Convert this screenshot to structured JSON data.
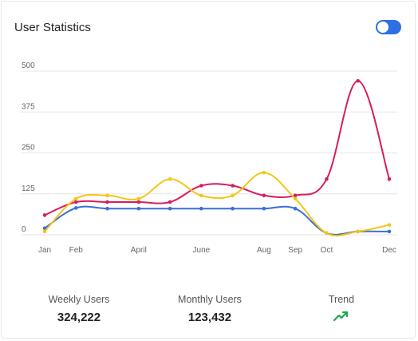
{
  "card": {
    "title": "User Statistics",
    "toggle_on": true
  },
  "stats": {
    "weekly_label": "Weekly Users",
    "weekly_value": "324,222",
    "monthly_label": "Monthly Users",
    "monthly_value": "123,432",
    "trend_label": "Trend",
    "trend_icon": "trending-up-icon"
  },
  "colors": {
    "accent": "#2f6fe4",
    "series_blue": "#3b6fd6",
    "series_pink": "#d81b60",
    "series_yellow": "#f5c518",
    "trend": "#1aa84b"
  },
  "chart_data": {
    "type": "line",
    "ylim": [
      0,
      500
    ],
    "y_ticks": [
      "0",
      "125",
      "250",
      "375",
      "500"
    ],
    "y_tick_values": [
      0,
      125,
      250,
      375,
      500
    ],
    "x_tick_labels": [
      {
        "label": "Jan",
        "x": 0
      },
      {
        "label": "Feb",
        "x": 1
      },
      {
        "label": "April",
        "x": 3
      },
      {
        "label": "June",
        "x": 5
      },
      {
        "label": "Aug",
        "x": 7
      },
      {
        "label": "Sep",
        "x": 8
      },
      {
        "label": "Oct",
        "x": 9
      },
      {
        "label": "Dec",
        "x": 11
      }
    ],
    "xlim": [
      0,
      11
    ],
    "grid": true,
    "legend": "none",
    "series": [
      {
        "color": "#3b6fd6",
        "x": [
          0,
          1,
          2,
          3,
          4,
          5,
          6,
          7,
          8,
          9,
          10,
          11
        ],
        "values": [
          20,
          82,
          80,
          80,
          80,
          80,
          80,
          80,
          80,
          5,
          10,
          10
        ]
      },
      {
        "color": "#d81b60",
        "x": [
          0,
          1,
          2,
          3,
          4,
          5,
          6,
          7,
          8,
          9,
          10,
          11
        ],
        "values": [
          60,
          100,
          100,
          100,
          100,
          150,
          150,
          120,
          120,
          170,
          470,
          170
        ]
      },
      {
        "color": "#f5c518",
        "x": [
          0,
          1,
          2,
          3,
          4,
          5,
          6,
          7,
          8,
          9,
          10,
          11
        ],
        "values": [
          10,
          110,
          120,
          110,
          170,
          120,
          120,
          190,
          110,
          5,
          10,
          30
        ]
      }
    ]
  }
}
